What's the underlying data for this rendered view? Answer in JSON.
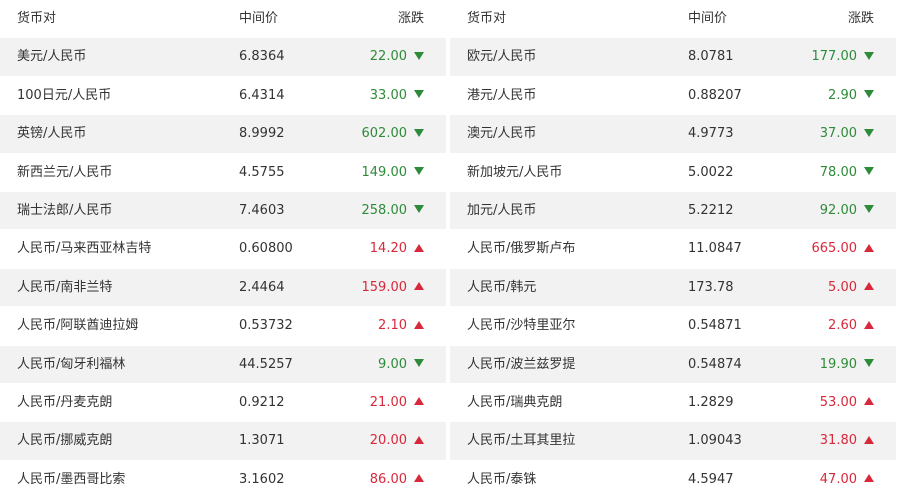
{
  "headers": {
    "pair": "货币对",
    "mid": "中间价",
    "change": "涨跌"
  },
  "colors": {
    "down": "#2e8b3a",
    "up": "#d8283b",
    "stripe": "#f2f2f2"
  },
  "left": [
    {
      "pair": "美元/人民币",
      "mid": "6.8364",
      "change": "22.00",
      "dir": "down"
    },
    {
      "pair": "100日元/人民币",
      "mid": "6.4314",
      "change": "33.00",
      "dir": "down"
    },
    {
      "pair": "英镑/人民币",
      "mid": "8.9992",
      "change": "602.00",
      "dir": "down"
    },
    {
      "pair": "新西兰元/人民币",
      "mid": "4.5755",
      "change": "149.00",
      "dir": "down"
    },
    {
      "pair": "瑞士法郎/人民币",
      "mid": "7.4603",
      "change": "258.00",
      "dir": "down"
    },
    {
      "pair": "人民币/马来西亚林吉特",
      "mid": "0.60800",
      "change": "14.20",
      "dir": "up"
    },
    {
      "pair": "人民币/南非兰特",
      "mid": "2.4464",
      "change": "159.00",
      "dir": "up"
    },
    {
      "pair": "人民币/阿联酋迪拉姆",
      "mid": "0.53732",
      "change": "2.10",
      "dir": "up"
    },
    {
      "pair": "人民币/匈牙利福林",
      "mid": "44.5257",
      "change": "9.00",
      "dir": "down"
    },
    {
      "pair": "人民币/丹麦克朗",
      "mid": "0.9212",
      "change": "21.00",
      "dir": "up"
    },
    {
      "pair": "人民币/挪威克朗",
      "mid": "1.3071",
      "change": "20.00",
      "dir": "up"
    },
    {
      "pair": "人民币/墨西哥比索",
      "mid": "3.1602",
      "change": "86.00",
      "dir": "up"
    }
  ],
  "right": [
    {
      "pair": "欧元/人民币",
      "mid": "8.0781",
      "change": "177.00",
      "dir": "down"
    },
    {
      "pair": "港元/人民币",
      "mid": "0.88207",
      "change": "2.90",
      "dir": "down"
    },
    {
      "pair": "澳元/人民币",
      "mid": "4.9773",
      "change": "37.00",
      "dir": "down"
    },
    {
      "pair": "新加坡元/人民币",
      "mid": "5.0022",
      "change": "78.00",
      "dir": "down"
    },
    {
      "pair": "加元/人民币",
      "mid": "5.2212",
      "change": "92.00",
      "dir": "down"
    },
    {
      "pair": "人民币/俄罗斯卢布",
      "mid": "11.0847",
      "change": "665.00",
      "dir": "up"
    },
    {
      "pair": "人民币/韩元",
      "mid": "173.78",
      "change": "5.00",
      "dir": "up"
    },
    {
      "pair": "人民币/沙特里亚尔",
      "mid": "0.54871",
      "change": "2.60",
      "dir": "up"
    },
    {
      "pair": "人民币/波兰兹罗提",
      "mid": "0.54874",
      "change": "19.90",
      "dir": "down"
    },
    {
      "pair": "人民币/瑞典克朗",
      "mid": "1.2829",
      "change": "53.00",
      "dir": "up"
    },
    {
      "pair": "人民币/土耳其里拉",
      "mid": "1.09043",
      "change": "31.80",
      "dir": "up"
    },
    {
      "pair": "人民币/泰铢",
      "mid": "4.5947",
      "change": "47.00",
      "dir": "up"
    }
  ]
}
